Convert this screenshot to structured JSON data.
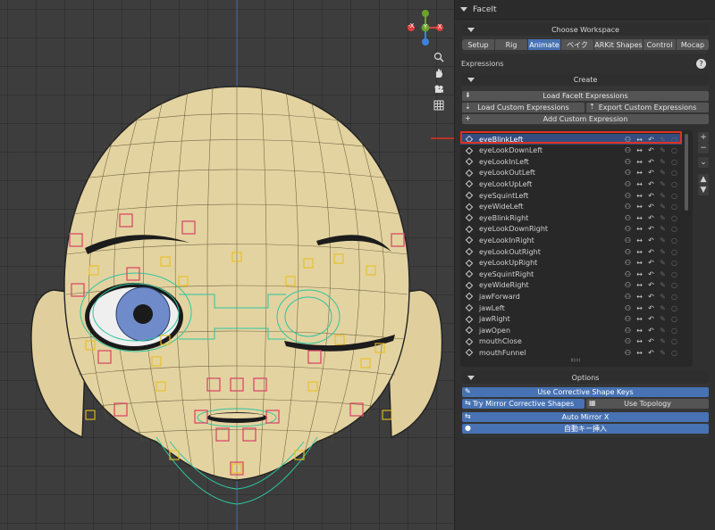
{
  "panel": {
    "title": "FaceIt",
    "workspace_title": "Choose Workspace",
    "tabs": [
      {
        "label": "Setup",
        "active": false
      },
      {
        "label": "Rig",
        "active": false
      },
      {
        "label": "Animate",
        "active": true
      },
      {
        "label": "ベイク",
        "active": false
      },
      {
        "label": "ARKit Shapes",
        "active": false
      },
      {
        "label": "Control",
        "active": false
      },
      {
        "label": "Mocap",
        "active": false
      }
    ],
    "expressions_label": "Expressions",
    "help_icon": "?",
    "create_title": "Create",
    "load_faceit_label": "Load FaceIt Expressions",
    "load_custom_label": "Load Custom Expressions",
    "export_custom_label": "Export Custom Expressions",
    "add_custom_label": "Add Custom Expression",
    "expressions": [
      "eyeBlinkLeft",
      "eyeLookDownLeft",
      "eyeLookInLeft",
      "eyeLookOutLeft",
      "eyeLookUpLeft",
      "eyeSquintLeft",
      "eyeWideLeft",
      "eyeBlinkRight",
      "eyeLookDownRight",
      "eyeLookInRight",
      "eyeLookOutRight",
      "eyeLookUpRight",
      "eyeSquintRight",
      "eyeWideRight",
      "jawForward",
      "jawLeft",
      "jawRight",
      "jawOpen",
      "mouthClose",
      "mouthFunnel"
    ],
    "selected_expression": "eyeBlinkLeft",
    "options_title": "Options",
    "use_corrective_label": "Use Corrective Shape Keys",
    "try_mirror_label": "Try Mirror Corrective Shapes",
    "use_topology_label": "Use Topology",
    "auto_mirror_label": "Auto Mirror X",
    "auto_key_label": "自動キー挿入"
  },
  "gizmo": {
    "axis_y_label": "Y",
    "axis_x_label": "X",
    "axis_neg_x_label": "-X",
    "color_x": "#e04040",
    "color_y": "#6aa32a",
    "color_z": "#3b82e0"
  },
  "icons": {
    "viewport": [
      "zoom-icon",
      "hand-pan-icon",
      "camera-icon",
      "grid-icon"
    ],
    "side": [
      "plus",
      "minus",
      "chevron-down",
      "arrow-up",
      "arrow-down"
    ]
  },
  "colors": {
    "accent": "#4772b3",
    "selection": "#334d80",
    "skin": "#e3d3a0",
    "eye_iris": "#6f8bc9",
    "control_red": "#d94a6a",
    "control_yellow": "#e8c020",
    "control_teal": "#2ec5a0",
    "arrow_red": "#e03020"
  }
}
